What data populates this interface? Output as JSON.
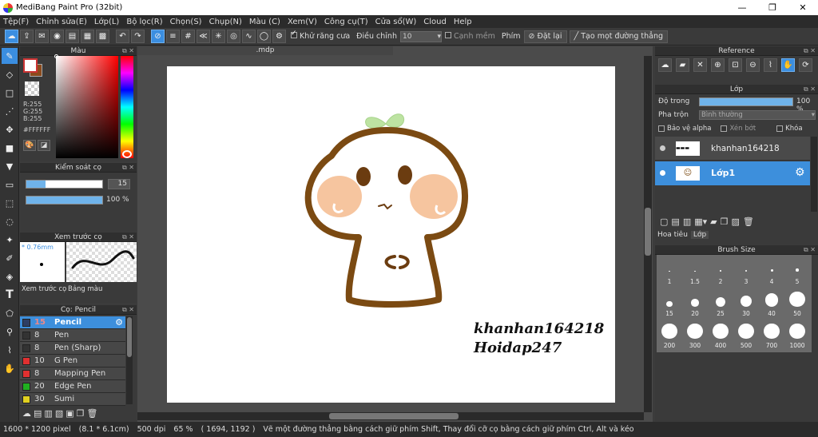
{
  "window": {
    "title": "MediBang Paint Pro (32bit)",
    "minimize": "—",
    "restore": "❐",
    "close": "✕"
  },
  "menu": [
    "Tệp(F)",
    "Chỉnh sửa(E)",
    "Lớp(L)",
    "Bộ lọc(R)",
    "Chọn(S)",
    "Chụp(N)",
    "Màu (C)",
    "Xem(V)",
    "Công cụ(T)",
    "Cửa sổ(W)",
    "Cloud",
    "Help"
  ],
  "toolbar": {
    "antialias_label": "Khử răng cưa",
    "adjust_label": "Điều chỉnh",
    "adjust_value": "10",
    "edge_label": "Cạnh mềm",
    "key_label": "Phím",
    "reset_label": "Đặt lại",
    "straight_line_label": "Tạo mọt đường thẳng"
  },
  "color_panel": {
    "title": "Màu",
    "r": "R:255",
    "g": "G:255",
    "b": "B:255",
    "hex": "#FFFFFF",
    "primary_color": "#ffffff",
    "secondary_color": "#8b4a1c"
  },
  "brush_control": {
    "title": "Kiểm soát cọ",
    "size_value": "15",
    "size_fraction": 0.25,
    "opacity_value": "100 %",
    "opacity_fraction": 1.0
  },
  "brush_preview": {
    "title": "Xem trước cọ",
    "size_text": "* 0.76mm",
    "tab_preview": "Xem trước cọ",
    "tab_palette": "Bảng màu"
  },
  "brush_list": {
    "title": "Cọ: Pencil",
    "items": [
      {
        "size": "15",
        "name": "Pencil",
        "color": "#2d3e64",
        "active": true
      },
      {
        "size": "8",
        "name": "Pen",
        "color": "#333333",
        "active": false
      },
      {
        "size": "8",
        "name": "Pen (Sharp)",
        "color": "#333333",
        "active": false
      },
      {
        "size": "10",
        "name": "G Pen",
        "color": "#e03030",
        "active": false
      },
      {
        "size": "8",
        "name": "Mapping Pen",
        "color": "#e03030",
        "active": false
      },
      {
        "size": "20",
        "name": "Edge Pen",
        "color": "#20b020",
        "active": false
      },
      {
        "size": "30",
        "name": "Sumi",
        "color": "#e0d020",
        "active": false
      }
    ]
  },
  "document": {
    "tab_title": ".mdp",
    "text_line1": "khanhan164218",
    "text_line2": "Hoidap247"
  },
  "reference_panel": {
    "title": "Reference"
  },
  "layer_panel": {
    "title": "Lớp",
    "opacity_label": "Độ trong",
    "opacity_value": "100 %",
    "opacity_fraction": 1.0,
    "blend_label": "Pha trộn",
    "blend_value": "Bình thường",
    "protect_alpha": "Bảo vệ alpha",
    "clipping": "Xén bớt",
    "lock": "Khóa",
    "layers": [
      {
        "name": "khanhan164218",
        "active": false
      },
      {
        "name": "Lớp1",
        "active": true
      }
    ],
    "tab_material": "Hoa tiêu",
    "tab_layer": "Lớp"
  },
  "brush_size_panel": {
    "title": "Brush Size",
    "sizes": [
      "1",
      "1.5",
      "2",
      "3",
      "4",
      "5",
      "15",
      "20",
      "25",
      "30",
      "40",
      "50",
      "200",
      "300",
      "400",
      "500",
      "700",
      "1000"
    ]
  },
  "status": {
    "size": "1600 * 1200 pixel",
    "cm": "(8.1 * 6.1cm)",
    "dpi": "500 dpi",
    "zoom": "65 %",
    "coords": "( 1694, 1192 )",
    "hint": "Vẽ một đường thẳng bằng cách giữ phím Shift, Thay đổi cỡ cọ bằng cách giữ phím Ctrl, Alt và kéo"
  },
  "colors": {
    "accent": "#3b8ee0",
    "drawing_brown": "#7b4a12",
    "cheek": "#f5c29a",
    "sprout": "#b8e29a"
  }
}
